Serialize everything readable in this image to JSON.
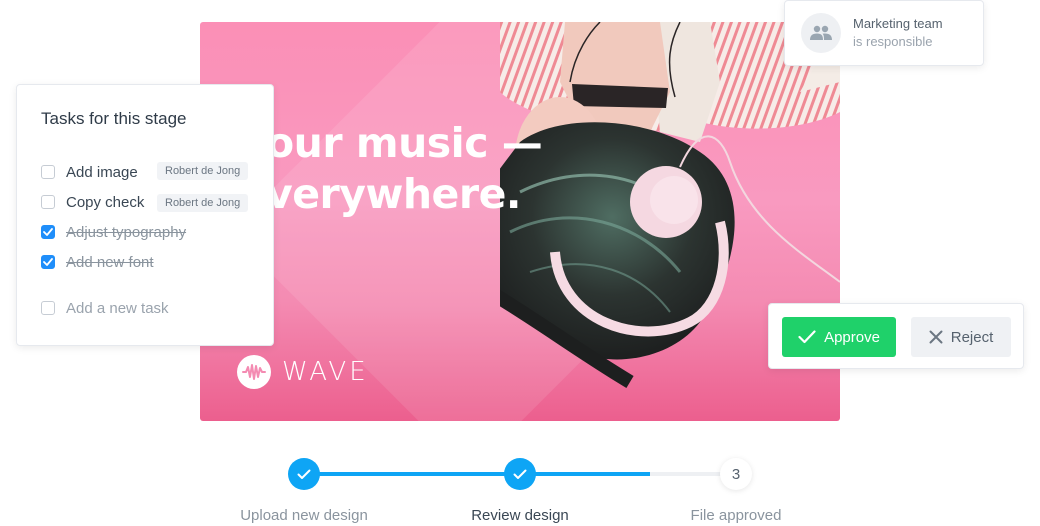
{
  "preview": {
    "headline_line1": "our music —",
    "headline_line2": "verywhere.",
    "brand_name": "WAVE",
    "brand_icon": "waveform-icon",
    "background_color": "#fb8fb6"
  },
  "tasks_panel": {
    "title": "Tasks for this stage",
    "tasks": [
      {
        "label": "Add image",
        "checked": false,
        "assignee": "Robert de Jong"
      },
      {
        "label": "Copy check",
        "checked": false,
        "assignee": "Robert de Jong"
      },
      {
        "label": "Adjust typography",
        "checked": true
      },
      {
        "label": "Add new font",
        "checked": true
      }
    ],
    "new_task_placeholder": "Add a new task",
    "check_color": "#1f8efa"
  },
  "owner_card": {
    "icon": "team-icon",
    "team": "Marketing team",
    "subtitle": "is responsible"
  },
  "actions": {
    "approve_label": "Approve",
    "reject_label": "Reject",
    "approve_color": "#1fd16a",
    "reject_color": "#eff1f4"
  },
  "stepper": {
    "accent_color": "#0ea5f5",
    "progress_fraction": 0.8,
    "steps": [
      {
        "label": "Upload new design",
        "state": "done"
      },
      {
        "label": "Review design",
        "state": "current-done"
      },
      {
        "label": "File approved",
        "state": "pending",
        "number": "3"
      }
    ]
  }
}
